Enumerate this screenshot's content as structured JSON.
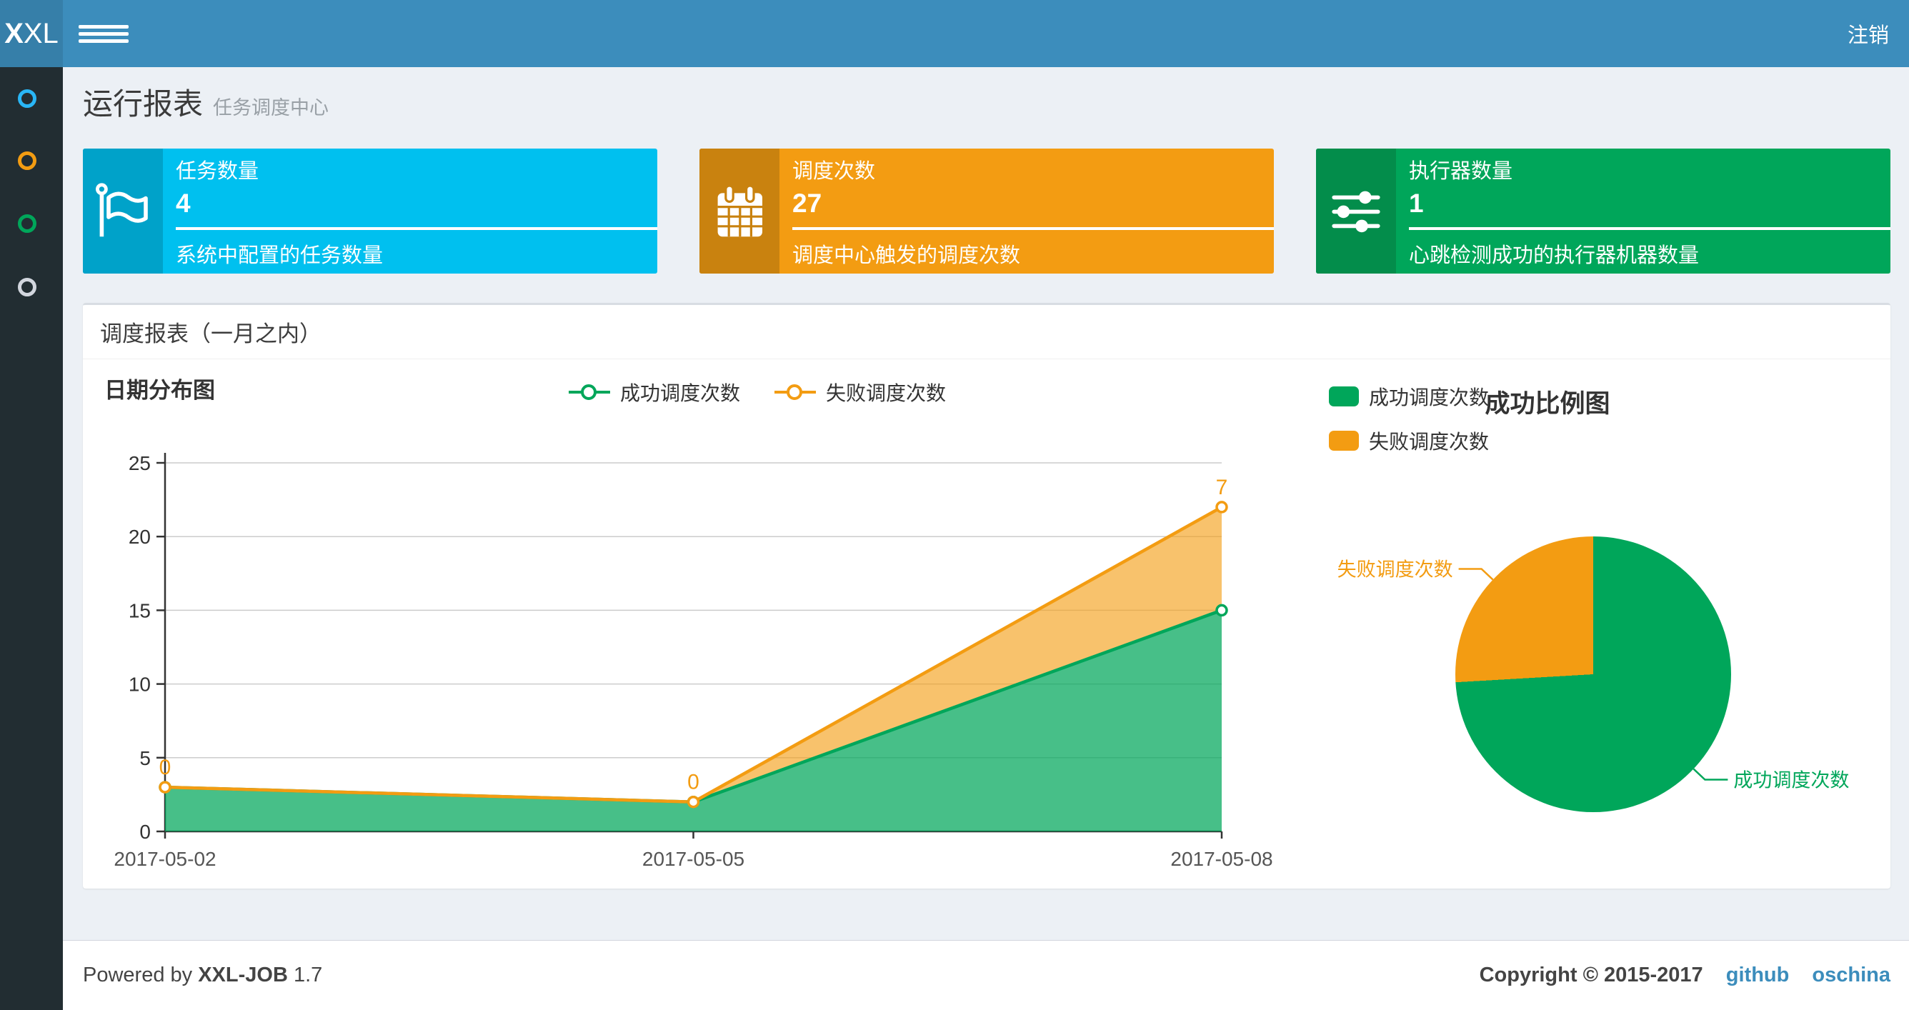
{
  "navbar": {
    "logo_bold": "X",
    "logo_rest": "XL",
    "logout_label": "注销"
  },
  "sidebar": {
    "items": [
      {
        "name": "menu-run-report",
        "color": "#29b6f6"
      },
      {
        "name": "menu-job-manage",
        "color": "#f39c12"
      },
      {
        "name": "menu-job-log",
        "color": "#00a65a"
      },
      {
        "name": "menu-executor-manage",
        "color": "#d2d6de"
      }
    ]
  },
  "page_header": {
    "title": "运行报表",
    "subtitle": "任务调度中心"
  },
  "stat_boxes": [
    {
      "label": "任务数量",
      "value": "4",
      "description": "系统中配置的任务数量",
      "bg": "#00c0ef",
      "icon_bg": "#00a2c9",
      "icon": "flag-icon"
    },
    {
      "label": "调度次数",
      "value": "27",
      "description": "调度中心触发的调度次数",
      "bg": "#f39c12",
      "icon_bg": "#c9820f",
      "icon": "calendar-icon"
    },
    {
      "label": "执行器数量",
      "value": "1",
      "description": "心跳检测成功的执行器机器数量",
      "bg": "#00a65a",
      "icon_bg": "#038d4b",
      "icon": "sliders-icon"
    }
  ],
  "report_panel": {
    "title": "调度报表（一月之内）"
  },
  "chart_data": [
    {
      "type": "area",
      "title": "日期分布图",
      "x": [
        "2017-05-02",
        "2017-05-05",
        "2017-05-08"
      ],
      "series": [
        {
          "name": "成功调度次数",
          "color": "#00a65a",
          "values": [
            3,
            2,
            15
          ]
        },
        {
          "name": "失败调度次数",
          "color": "#f39c12",
          "values": [
            0,
            0,
            7
          ],
          "point_labels": [
            "0",
            "0",
            "7"
          ]
        }
      ],
      "stacked": true,
      "ylim": [
        0,
        25
      ],
      "yticks": [
        0,
        5,
        10,
        15,
        20,
        25
      ],
      "grid": true,
      "legend_position": "top-center",
      "axis_color": "#333333",
      "grid_color": "#cccccc"
    },
    {
      "type": "pie",
      "title": "成功比例图",
      "slices": [
        {
          "name": "成功调度次数",
          "value": 20,
          "color": "#00a65a"
        },
        {
          "name": "失败调度次数",
          "value": 7,
          "color": "#f39c12"
        }
      ],
      "legend_position": "top-left"
    }
  ],
  "footer": {
    "powered_prefix": "Powered by",
    "product": "XXL-JOB",
    "version": "1.7",
    "copyright": "Copyright © 2015-2017",
    "links": [
      "github",
      "oschina"
    ]
  },
  "theme": {
    "navbar_bg": "#3c8dbc",
    "logo_bg": "#367fa9",
    "sidebar_bg": "#222d32",
    "content_bg": "#ecf0f5",
    "success_color": "#00a65a",
    "fail_color": "#f39c12",
    "info_color": "#00c0ef"
  }
}
